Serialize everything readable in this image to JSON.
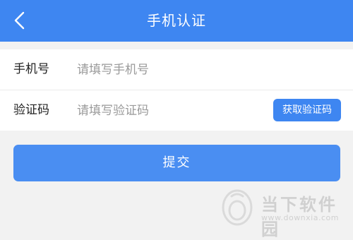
{
  "header": {
    "title": "手机认证",
    "back_icon": "chevron-left-icon",
    "background": "#3e86f1"
  },
  "form": {
    "phone": {
      "label": "手机号",
      "placeholder": "请填写手机号",
      "value": ""
    },
    "code": {
      "label": "验证码",
      "placeholder": "请填写验证码",
      "value": "",
      "get_code_label": "获取验证码"
    }
  },
  "submit": {
    "label": "提交",
    "color": "#4a8ef2"
  },
  "watermark": {
    "name": "当下软件园",
    "url": "www.downxia.com"
  }
}
